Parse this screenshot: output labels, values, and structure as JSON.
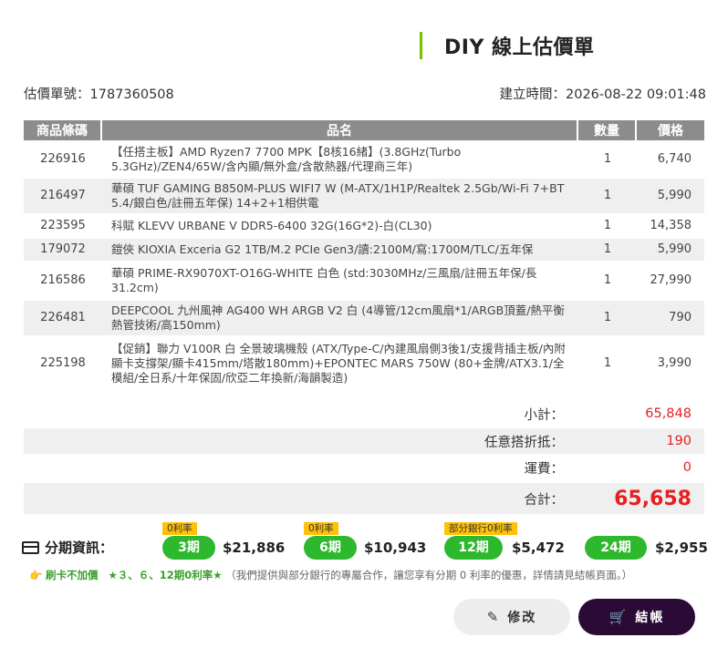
{
  "header": {
    "title": "DIY 線上估價單"
  },
  "meta": {
    "quote_no_label": "估價單號：",
    "quote_no": "1787360508",
    "created_label": "建立時間：",
    "created_at": "2026-08-22 09:01:48"
  },
  "table": {
    "headers": [
      "商品條碼",
      "品名",
      "數量",
      "價格"
    ],
    "rows": [
      {
        "code": "226916",
        "name": "【任搭主板】AMD Ryzen7 7700 MPK【8核16緒】(3.8GHz(Turbo 5.3GHz)/ZEN4/65W/含內顯/無外盒/含散熱器/代理商三年)",
        "qty": "1",
        "price": "6,740"
      },
      {
        "code": "216497",
        "name": "華碩 TUF GAMING B850M-PLUS WIFI7 W (M-ATX/1H1P/Realtek 2.5Gb/Wi-Fi 7+BT 5.4/銀白色/註冊五年保) 14+2+1相供電",
        "qty": "1",
        "price": "5,990"
      },
      {
        "code": "223595",
        "name": "科賦 KLEVV URBANE V DDR5-6400 32G(16G*2)-白(CL30)",
        "qty": "1",
        "price": "14,358"
      },
      {
        "code": "179072",
        "name": "鎧俠 KIOXIA Exceria G2 1TB/M.2 PCIe Gen3/讀:2100M/寫:1700M/TLC/五年保",
        "qty": "1",
        "price": "5,990"
      },
      {
        "code": "216586",
        "name": "華碩 PRIME-RX9070XT-O16G-WHITE 白色 (std:3030MHz/三風扇/註冊五年保/長31.2cm)",
        "qty": "1",
        "price": "27,990"
      },
      {
        "code": "226481",
        "name": "DEEPCOOL 九州風神 AG400 WH ARGB V2 白 (4導管/12cm風扇*1/ARGB頂蓋/熱平衡熱管技術/高150mm)",
        "qty": "1",
        "price": "790"
      },
      {
        "code": "225198",
        "name": "【促銷】聯力 V100R 白 全景玻璃機殼 (ATX/Type-C/內建風扇側3後1/支援背插主板/內附顯卡支撐架/顯卡415mm/塔散180mm)+EPONTEC MARS 750W (80+金牌/ATX3.1/全模組/全日系/十年保固/欣亞二年換新/海韻製造)",
        "qty": "1",
        "price": "3,990"
      }
    ]
  },
  "summary": {
    "subtotal_label": "小計：",
    "subtotal": "65,848",
    "discount_label": "任意搭折抵：",
    "discount": "190",
    "shipping_label": "運費：",
    "shipping": "0",
    "total_label": "合計：",
    "total": "65,658"
  },
  "installment": {
    "label": "分期資訊：",
    "plans": [
      {
        "tag": "0利率",
        "term": "3期",
        "amount": "$21,886"
      },
      {
        "tag": "0利率",
        "term": "6期",
        "amount": "$10,943"
      },
      {
        "tag": "部分銀行0利率",
        "term": "12期",
        "amount": "$5,472"
      },
      {
        "tag": "",
        "term": "24期",
        "amount": "$2,955"
      }
    ]
  },
  "promo": {
    "icon": "👉",
    "text1": "刷卡不加價",
    "text2": "★３、６、12期0利率★",
    "note": "（我們提供與部分銀行的專屬合作，讓您享有分期 0 利率的優惠，詳情請見結帳頁面。）"
  },
  "buttons": {
    "edit": "修改",
    "checkout": "結帳"
  },
  "colors": {
    "accent_green": "#2eb82e",
    "price_red": "#e62020",
    "checkout_bg": "#2b0a35",
    "tag_yellow": "#ffc107"
  }
}
